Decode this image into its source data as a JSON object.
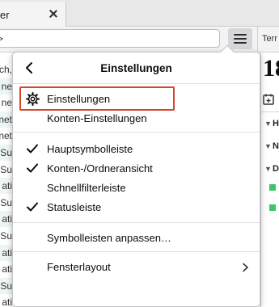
{
  "tab": {
    "title": "er"
  },
  "address": {
    "arrow": ">"
  },
  "toolbar_right": {
    "label": "Terr"
  },
  "message_list": {
    "fragments": [
      "ch,",
      "ne",
      "ne",
      "net",
      "net",
      "t Su",
      "t Su",
      "ati",
      "Su",
      "ati",
      "t Su",
      "ati",
      "ati",
      "Su",
      "ati"
    ]
  },
  "calendar_panel": {
    "big_date": "18",
    "section_letters": [
      "H",
      "N",
      "D"
    ]
  },
  "menu": {
    "title": "Einstellungen",
    "items": [
      {
        "label": "Einstellungen",
        "icon": "gear-icon",
        "checked": false
      },
      {
        "label": "Konten-Einstellungen",
        "checked": false
      },
      {
        "label": "Hauptsymbolleiste",
        "checked": true
      },
      {
        "label": "Konten-/Ordneransicht",
        "checked": true
      },
      {
        "label": "Schnellfilterleiste",
        "checked": false
      },
      {
        "label": "Statusleiste",
        "checked": true
      },
      {
        "label": "Symbolleisten anpassen…",
        "checked": false
      },
      {
        "label": "Fensterlayout",
        "submenu": true
      }
    ]
  },
  "colors": {
    "highlight_border": "#d4472b",
    "calendar_green": "#3ec56b",
    "menu_button_active": "#d7d7db"
  }
}
